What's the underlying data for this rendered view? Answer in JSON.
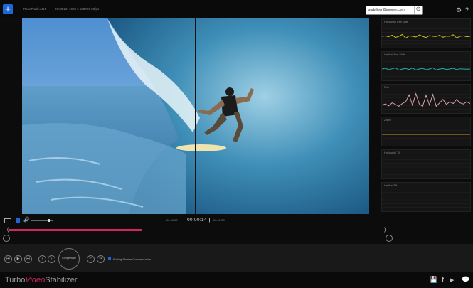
{
  "topbar": {
    "add_label": "+",
    "file_name": "RaceTrack.AR4",
    "duration": "00:00:23",
    "resolution": "1920 x 1080",
    "fps": "29.00fps",
    "account_email": "stabilizer@movee.com",
    "settings_icon": "gear-icon",
    "help_label": "?"
  },
  "graphs": [
    {
      "title": "Horizontal Pan Shift",
      "color": "#c9c21e",
      "values": [
        0.5,
        0.52,
        0.48,
        0.55,
        0.45,
        0.5,
        0.58,
        0.42,
        0.52,
        0.5,
        0.47,
        0.56,
        0.5,
        0.44,
        0.53,
        0.5,
        0.49,
        0.55,
        0.46,
        0.51,
        0.5,
        0.57,
        0.43,
        0.5,
        0.52,
        0.48,
        0.5
      ]
    },
    {
      "title": "Vertical Pan Shift",
      "color": "#1fb3a5",
      "values": [
        0.5,
        0.53,
        0.47,
        0.51,
        0.55,
        0.45,
        0.5,
        0.52,
        0.48,
        0.54,
        0.46,
        0.5,
        0.53,
        0.47,
        0.5,
        0.55,
        0.46,
        0.5,
        0.52,
        0.48,
        0.5,
        0.53,
        0.47,
        0.51,
        0.5,
        0.49,
        0.5
      ]
    },
    {
      "title": "Roll",
      "color": "#d9a0a8",
      "values": [
        0.35,
        0.4,
        0.32,
        0.45,
        0.38,
        0.3,
        0.42,
        0.5,
        0.8,
        0.35,
        0.85,
        0.4,
        0.3,
        0.78,
        0.36,
        0.82,
        0.3,
        0.45,
        0.6,
        0.38,
        0.5,
        0.42,
        0.6,
        0.45,
        0.4,
        0.5,
        0.42
      ]
    },
    {
      "title": "Zoom",
      "color": "#d48a1f",
      "values": [
        0.5,
        0.5,
        0.5,
        0.5,
        0.5,
        0.5,
        0.5,
        0.5,
        0.5,
        0.5,
        0.5,
        0.5,
        0.5,
        0.5,
        0.5,
        0.5,
        0.5,
        0.5,
        0.5,
        0.5,
        0.5,
        0.5,
        0.5,
        0.5,
        0.5,
        0.5,
        0.5
      ]
    },
    {
      "title": "Horizontal Tilt",
      "color": "#3a4a8a",
      "values": []
    },
    {
      "title": "Vertical Tilt",
      "color": "#3a4a8a",
      "values": []
    }
  ],
  "transport": {
    "time_start": "00:00:00",
    "time_current": "00:00:14",
    "time_end": "00:00:23",
    "progress": 0.355
  },
  "controls": {
    "compensate_label": "Compensate",
    "rolling_shutter_label": "Rolling Shutter Compensation"
  },
  "brand": {
    "part1": "Turbo",
    "part2": "Video",
    "part3": "Stabilizer"
  },
  "colors": {
    "accent": "#d3255e",
    "blue": "#1f67d6"
  }
}
